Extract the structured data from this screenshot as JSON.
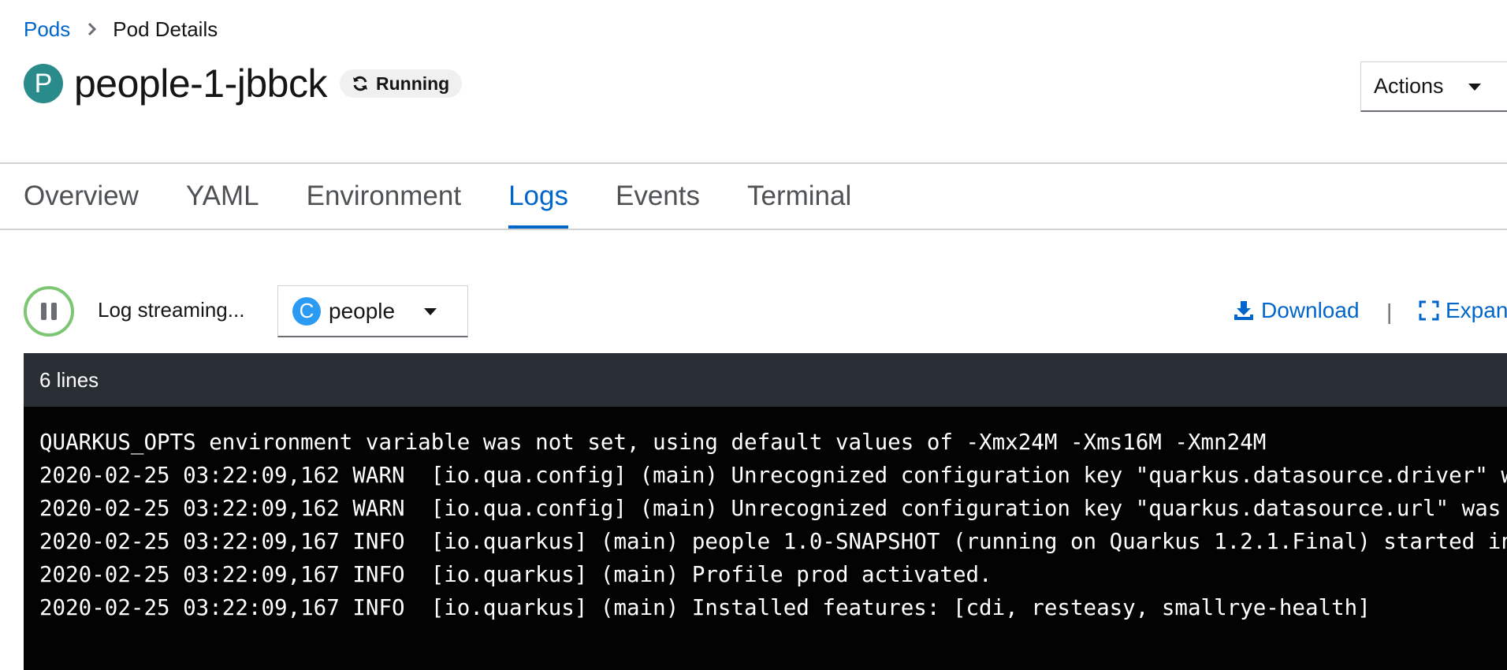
{
  "breadcrumb": {
    "parent": "Pods",
    "current": "Pod Details"
  },
  "header": {
    "badge": "P",
    "title": "people-1-jbbck",
    "status": "Running",
    "actions_label": "Actions"
  },
  "tabs": [
    {
      "label": "Overview",
      "active": false
    },
    {
      "label": "YAML",
      "active": false
    },
    {
      "label": "Environment",
      "active": false
    },
    {
      "label": "Logs",
      "active": true
    },
    {
      "label": "Events",
      "active": false
    },
    {
      "label": "Terminal",
      "active": false
    }
  ],
  "toolbar": {
    "streaming_label": "Log streaming...",
    "container": {
      "badge": "C",
      "name": "people"
    },
    "download_label": "Download",
    "separator": "|",
    "expand_label": "Expand"
  },
  "log": {
    "line_count_label": "6 lines",
    "lines": [
      "QUARKUS_OPTS environment variable was not set, using default values of -Xmx24M -Xms16M -Xmn24M",
      "2020-02-25 03:22:09,162 WARN  [io.qua.config] (main) Unrecognized configuration key \"quarkus.datasource.driver\" was provided",
      "2020-02-25 03:22:09,162 WARN  [io.qua.config] (main) Unrecognized configuration key \"quarkus.datasource.url\" was provided",
      "2020-02-25 03:22:09,167 INFO  [io.quarkus] (main) people 1.0-SNAPSHOT (running on Quarkus 1.2.1.Final) started in",
      "2020-02-25 03:22:09,167 INFO  [io.quarkus] (main) Profile prod activated.",
      "2020-02-25 03:22:09,167 INFO  [io.quarkus] (main) Installed features: [cdi, resteasy, smallrye-health]"
    ]
  },
  "colors": {
    "link": "#0066cc",
    "pod_badge": "#2a8b8b",
    "container_badge": "#2b9af3",
    "streaming_ring": "#7cc674",
    "log_header_bg": "#292e34",
    "log_body_bg": "#030303"
  },
  "icons": {
    "breadcrumb_separator": "chevron-right-icon",
    "status": "sync-icon",
    "actions": "caret-down-icon",
    "streaming": "pause-icon",
    "download": "download-icon",
    "expand": "expand-icon"
  }
}
